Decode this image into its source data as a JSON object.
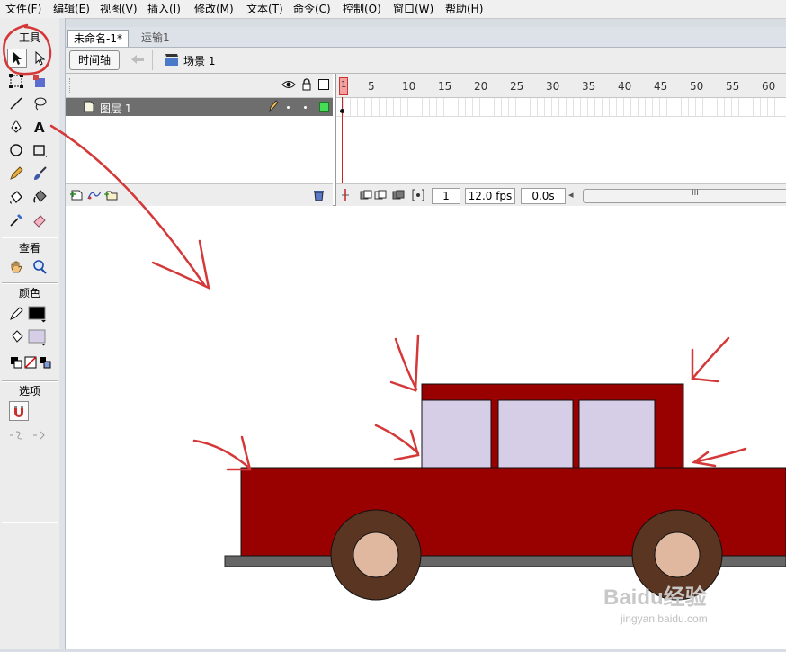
{
  "menu": [
    "文件(F)",
    "编辑(E)",
    "视图(V)",
    "插入(I)",
    "修改(M)",
    "文本(T)",
    "命令(C)",
    "控制(O)",
    "窗口(W)",
    "帮助(H)"
  ],
  "tools": {
    "title": "工具",
    "view_title": "查看",
    "color_title": "颜色",
    "options_title": "选项"
  },
  "tabs": [
    "未命名-1*",
    "运输1"
  ],
  "scene": {
    "timeline_button": "时间轴",
    "scene_label": "场景 1"
  },
  "timeline": {
    "frame_numbers": [
      "1",
      "5",
      "10",
      "15",
      "20",
      "25",
      "30",
      "35",
      "40",
      "45",
      "50",
      "55",
      "60"
    ],
    "layer_name": "图层 1",
    "current_frame": "1",
    "fps": "12.0 fps",
    "elapsed": "0.0s",
    "scrollbar_grip": "III"
  },
  "watermark": {
    "brand": "Baidu经验",
    "url": "jingyan.baidu.com"
  },
  "colors": {
    "car_body": "#990000",
    "car_window": "#d6cde6",
    "tire": "#5a3622",
    "hub": "#e0b8a0",
    "road": "#666666",
    "annotation": "#d43838",
    "layer_row": "#6e6e6e",
    "playhead": "#cc2222"
  }
}
